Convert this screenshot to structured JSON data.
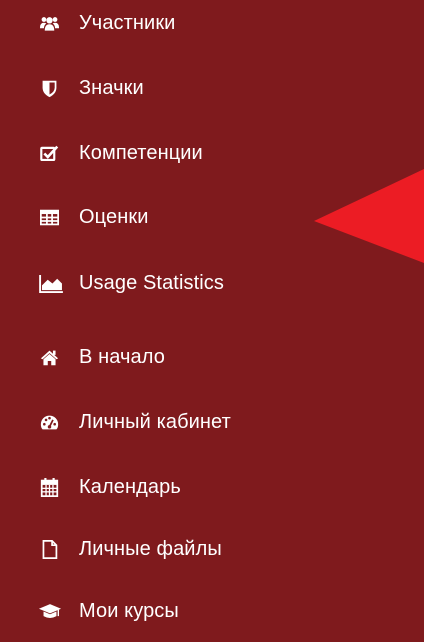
{
  "sidebar": {
    "background": "#7f1a1d",
    "text_color": "#ffffff",
    "items": [
      {
        "label": "Участники",
        "icon": "users-icon"
      },
      {
        "label": "Значки",
        "icon": "shield-icon"
      },
      {
        "label": "Компетенции",
        "icon": "checkbox-icon"
      },
      {
        "label": "Оценки",
        "icon": "table-icon"
      },
      {
        "label": "Usage Statistics",
        "icon": "area-chart-icon"
      },
      {
        "label": "В начало",
        "icon": "home-icon"
      },
      {
        "label": "Личный кабинет",
        "icon": "dashboard-icon"
      },
      {
        "label": "Календарь",
        "icon": "calendar-icon"
      },
      {
        "label": "Личные файлы",
        "icon": "file-icon"
      },
      {
        "label": "Мои курсы",
        "icon": "graduation-cap-icon"
      }
    ]
  },
  "annotation": {
    "arrow_color": "#ec1c24",
    "points_to": "Оценки"
  }
}
